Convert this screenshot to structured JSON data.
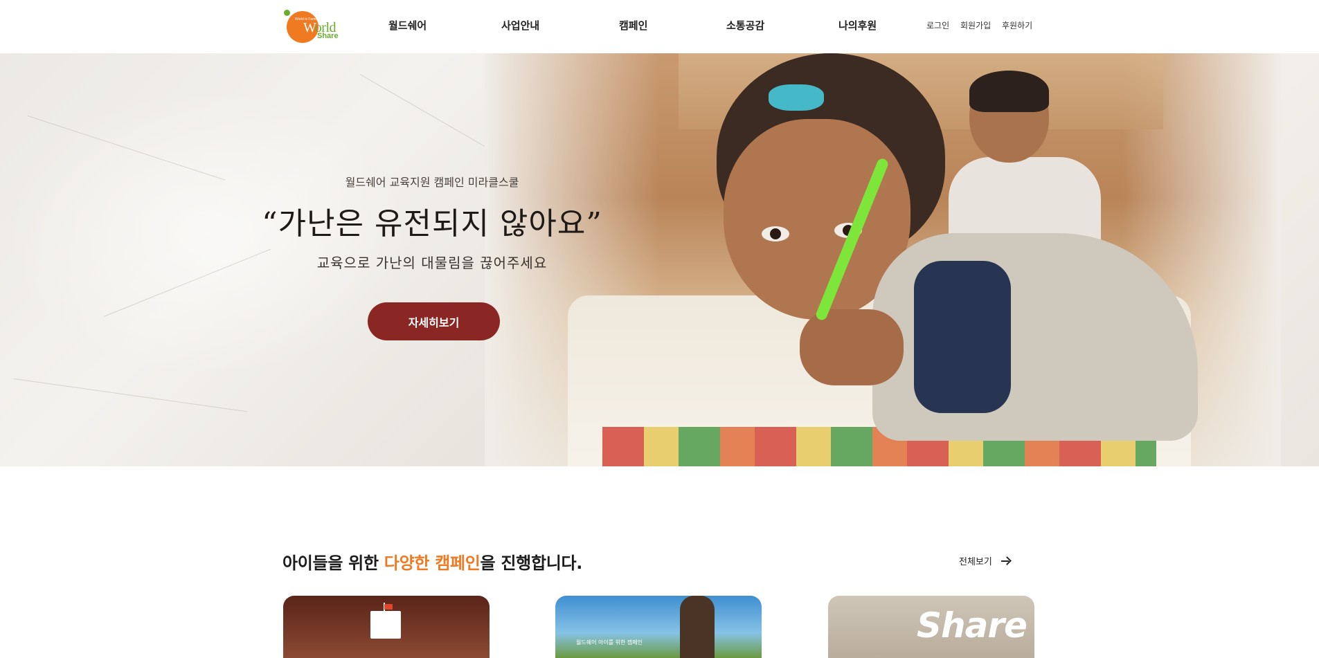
{
  "header": {
    "logo": {
      "tagline": "World is Family Share it",
      "word1_first": "W",
      "word1_rest": "orld",
      "word2": "Share"
    },
    "nav": [
      "월드쉐어",
      "사업안내",
      "캠페인",
      "소통공감",
      "나의후원"
    ],
    "util": {
      "login": "로그인",
      "signup": "회원가입",
      "donate": "후원하기"
    }
  },
  "hero": {
    "subtitle": "월드쉐어 교육지원 캠페인 미라클스쿨",
    "title": "“가난은 유전되지 않아요”",
    "description": "교육으로 가난의 대물림을 끊어주세요",
    "button": "자세히보기"
  },
  "campaigns": {
    "title_prefix": "아이들을 위한 ",
    "title_highlight": "다양한 캠페인",
    "title_suffix": "을 진행합니다.",
    "view_all": "전체보기",
    "card2_caption": "월드쉐어 아이를 위한 캠페인",
    "card3_word": "Share"
  },
  "colors": {
    "accent": "#f07a22",
    "button": "#8a2724",
    "logo_green": "#6aab2e"
  }
}
